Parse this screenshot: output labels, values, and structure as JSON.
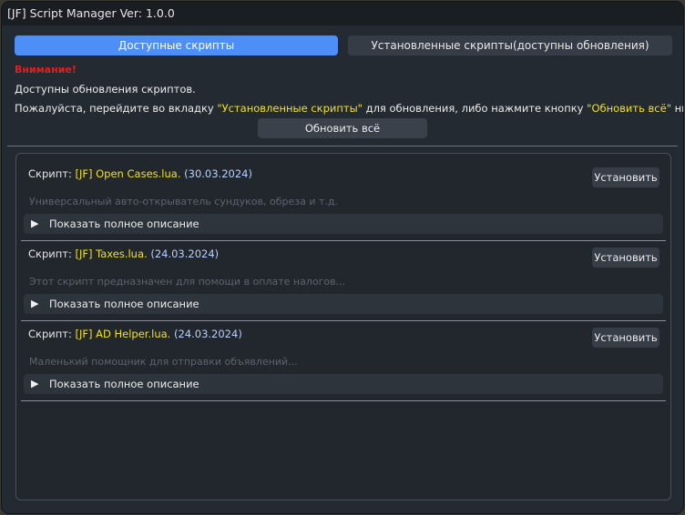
{
  "window": {
    "title": "[JF] Script Manager Ver: 1.0.0"
  },
  "tabs": [
    {
      "label": "Доступные скрипты",
      "active": true
    },
    {
      "label": "Установленные скрипты(доступны обновления)",
      "active": false
    }
  ],
  "notice": {
    "warning": "Внимание!",
    "line1": "Доступны обновления скриптов.",
    "line2_a": "Пожалуйста, перейдите во вкладку ",
    "line2_tab": "\"Установленные скрипты\"",
    "line2_b": " для обновления, либо нажмите кнопку ",
    "line2_btn": "\"Обновить всё\"",
    "line2_c": " ниже."
  },
  "update_all_label": "Обновить всё",
  "scripts": [
    {
      "prefix": "Скрипт: ",
      "name": "[JF] Open Cases.lua.",
      "date": "(30.03.2024)",
      "description": "Универсальный авто-открыватель сундуков, обреза и т.д.",
      "install_label": "Установить",
      "expand_label": "Показать полное описание"
    },
    {
      "prefix": "Скрипт: ",
      "name": "[JF] Taxes.lua.",
      "date": "(24.03.2024)",
      "description": "Этот скрипт предназначен для помощи в оплате налогов...",
      "install_label": "Установить",
      "expand_label": "Показать полное описание"
    },
    {
      "prefix": "Скрипт: ",
      "name": "[JF] AD Helper.lua.",
      "date": "(24.03.2024)",
      "description": "Маленький помощник для отправки объявлений...",
      "install_label": "Установить",
      "expand_label": "Показать полное описание"
    }
  ],
  "colors": {
    "accent": "#4d8ef7",
    "warning": "#e02020",
    "highlight": "#f0e020",
    "date": "#b8d0ff"
  },
  "icons": {
    "expand": "triangle-right-icon"
  }
}
